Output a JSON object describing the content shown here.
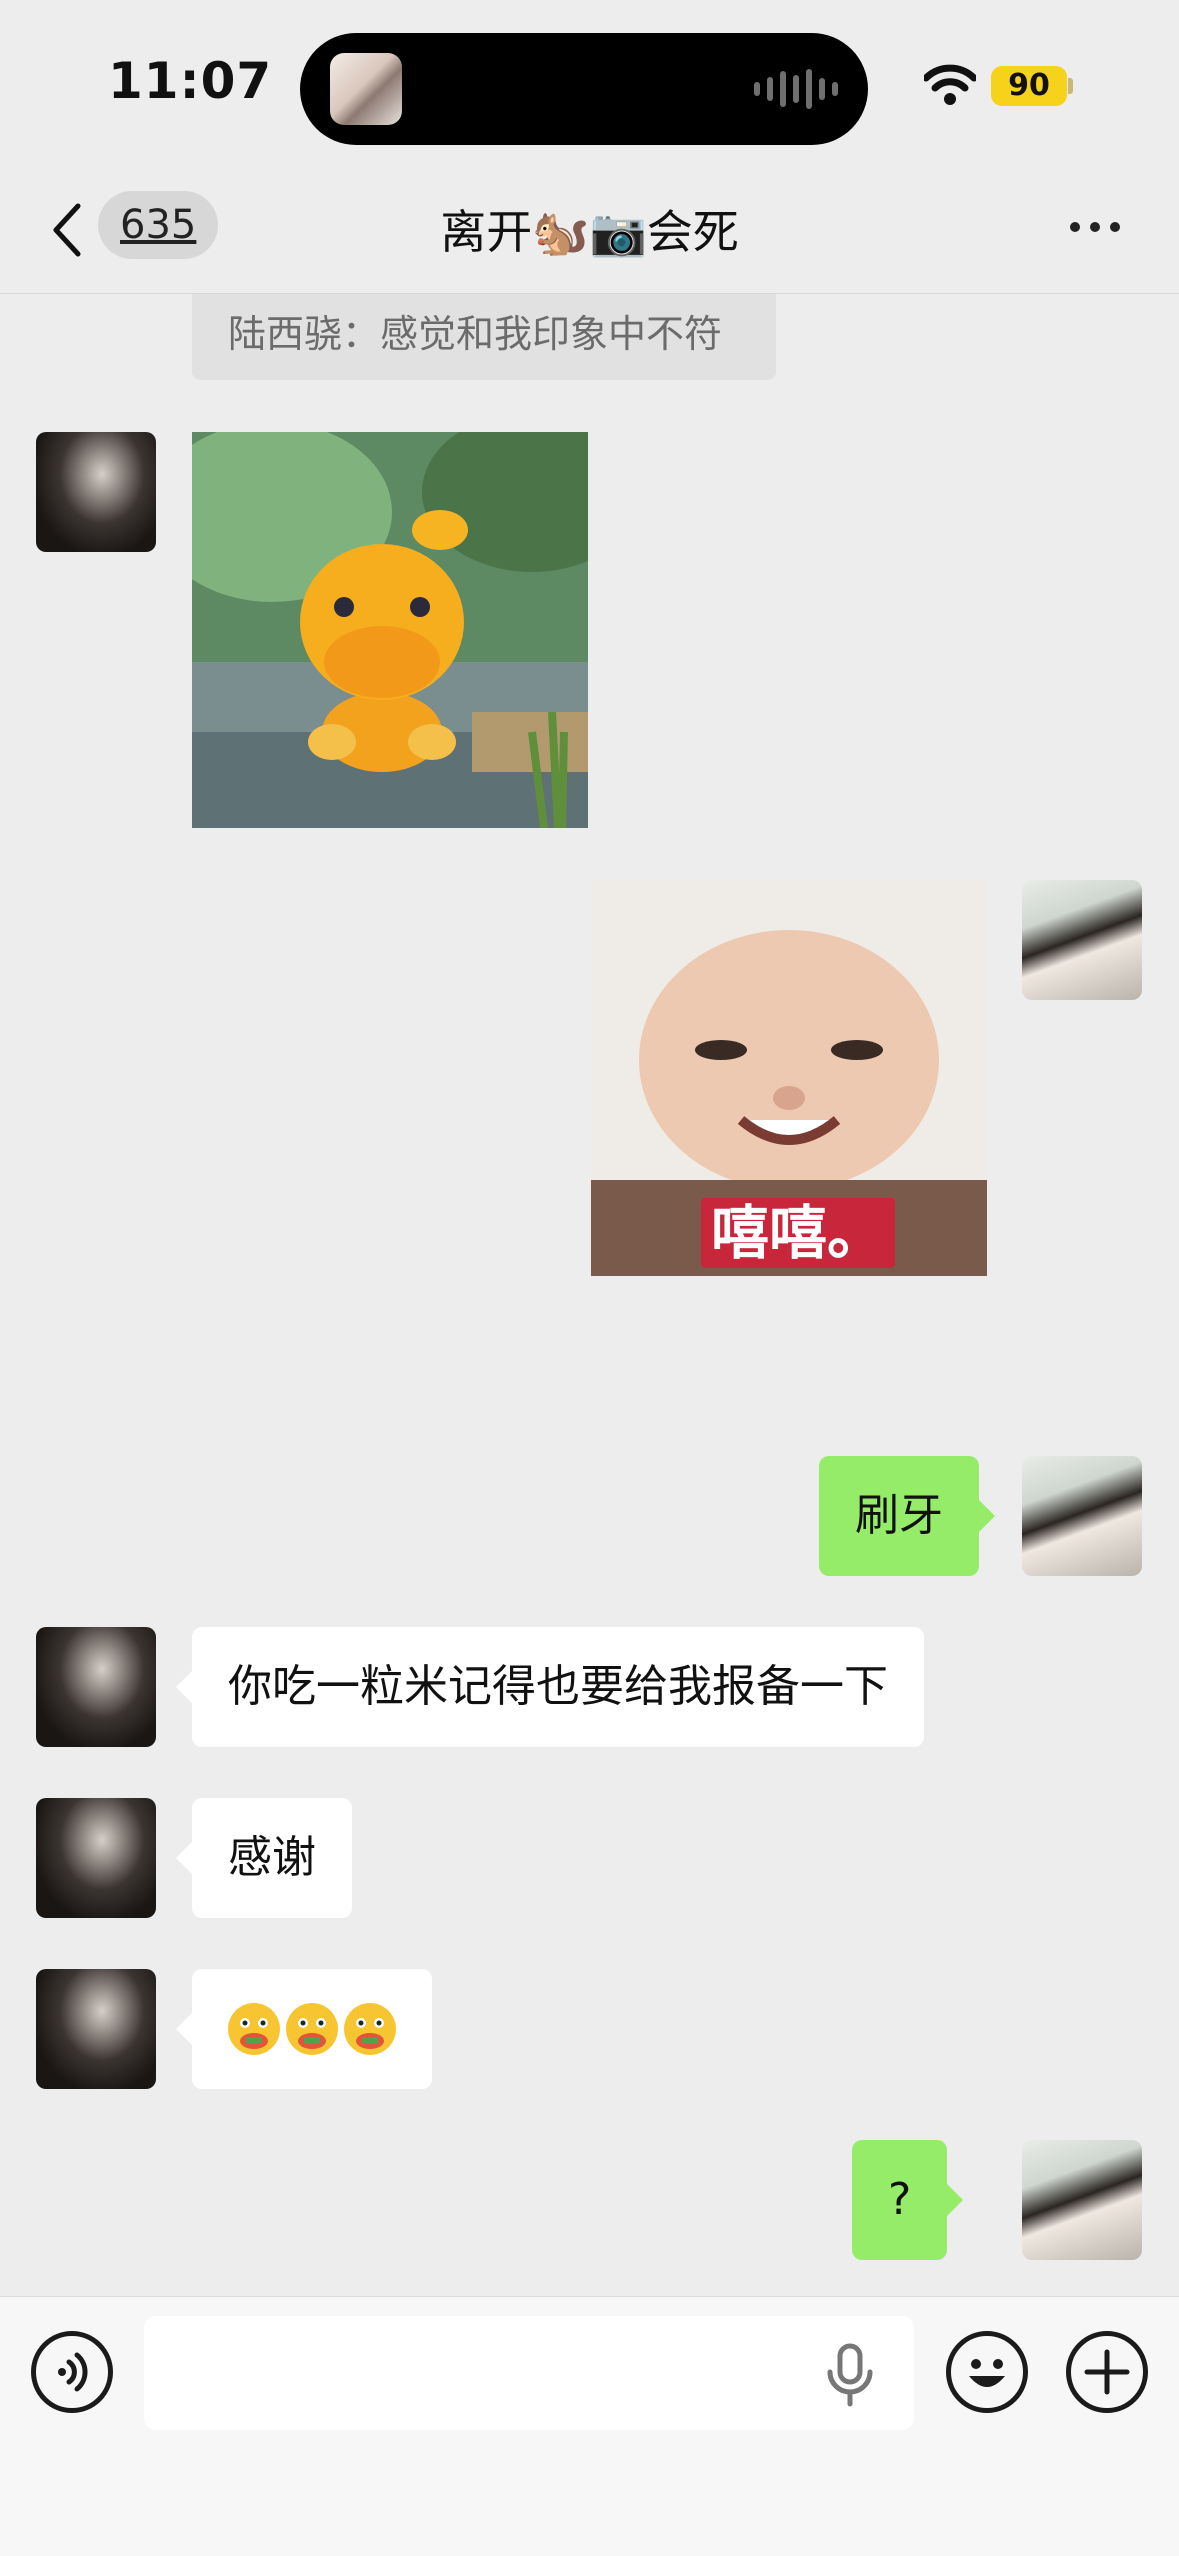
{
  "status_bar": {
    "time": "11:07",
    "battery": "90"
  },
  "nav": {
    "back_count": "635",
    "title": "离开🐿️📷会死"
  },
  "quote": {
    "text": "陆西骁：感觉和我印象中不符"
  },
  "messages": {
    "face_caption": "嘻嘻。",
    "brush_teeth": "刷牙",
    "report": "你吃一粒米记得也要给我报备一下",
    "thanks": "感谢",
    "question": "?"
  },
  "colors": {
    "background": "#ededed",
    "outgoing_bubble": "#95ec69",
    "incoming_bubble": "#ffffff",
    "battery": "#f7d21a"
  },
  "icons": [
    "back-icon",
    "more-icon",
    "wifi-icon",
    "voice-icon",
    "microphone-icon",
    "emoji-icon",
    "plus-icon"
  ]
}
